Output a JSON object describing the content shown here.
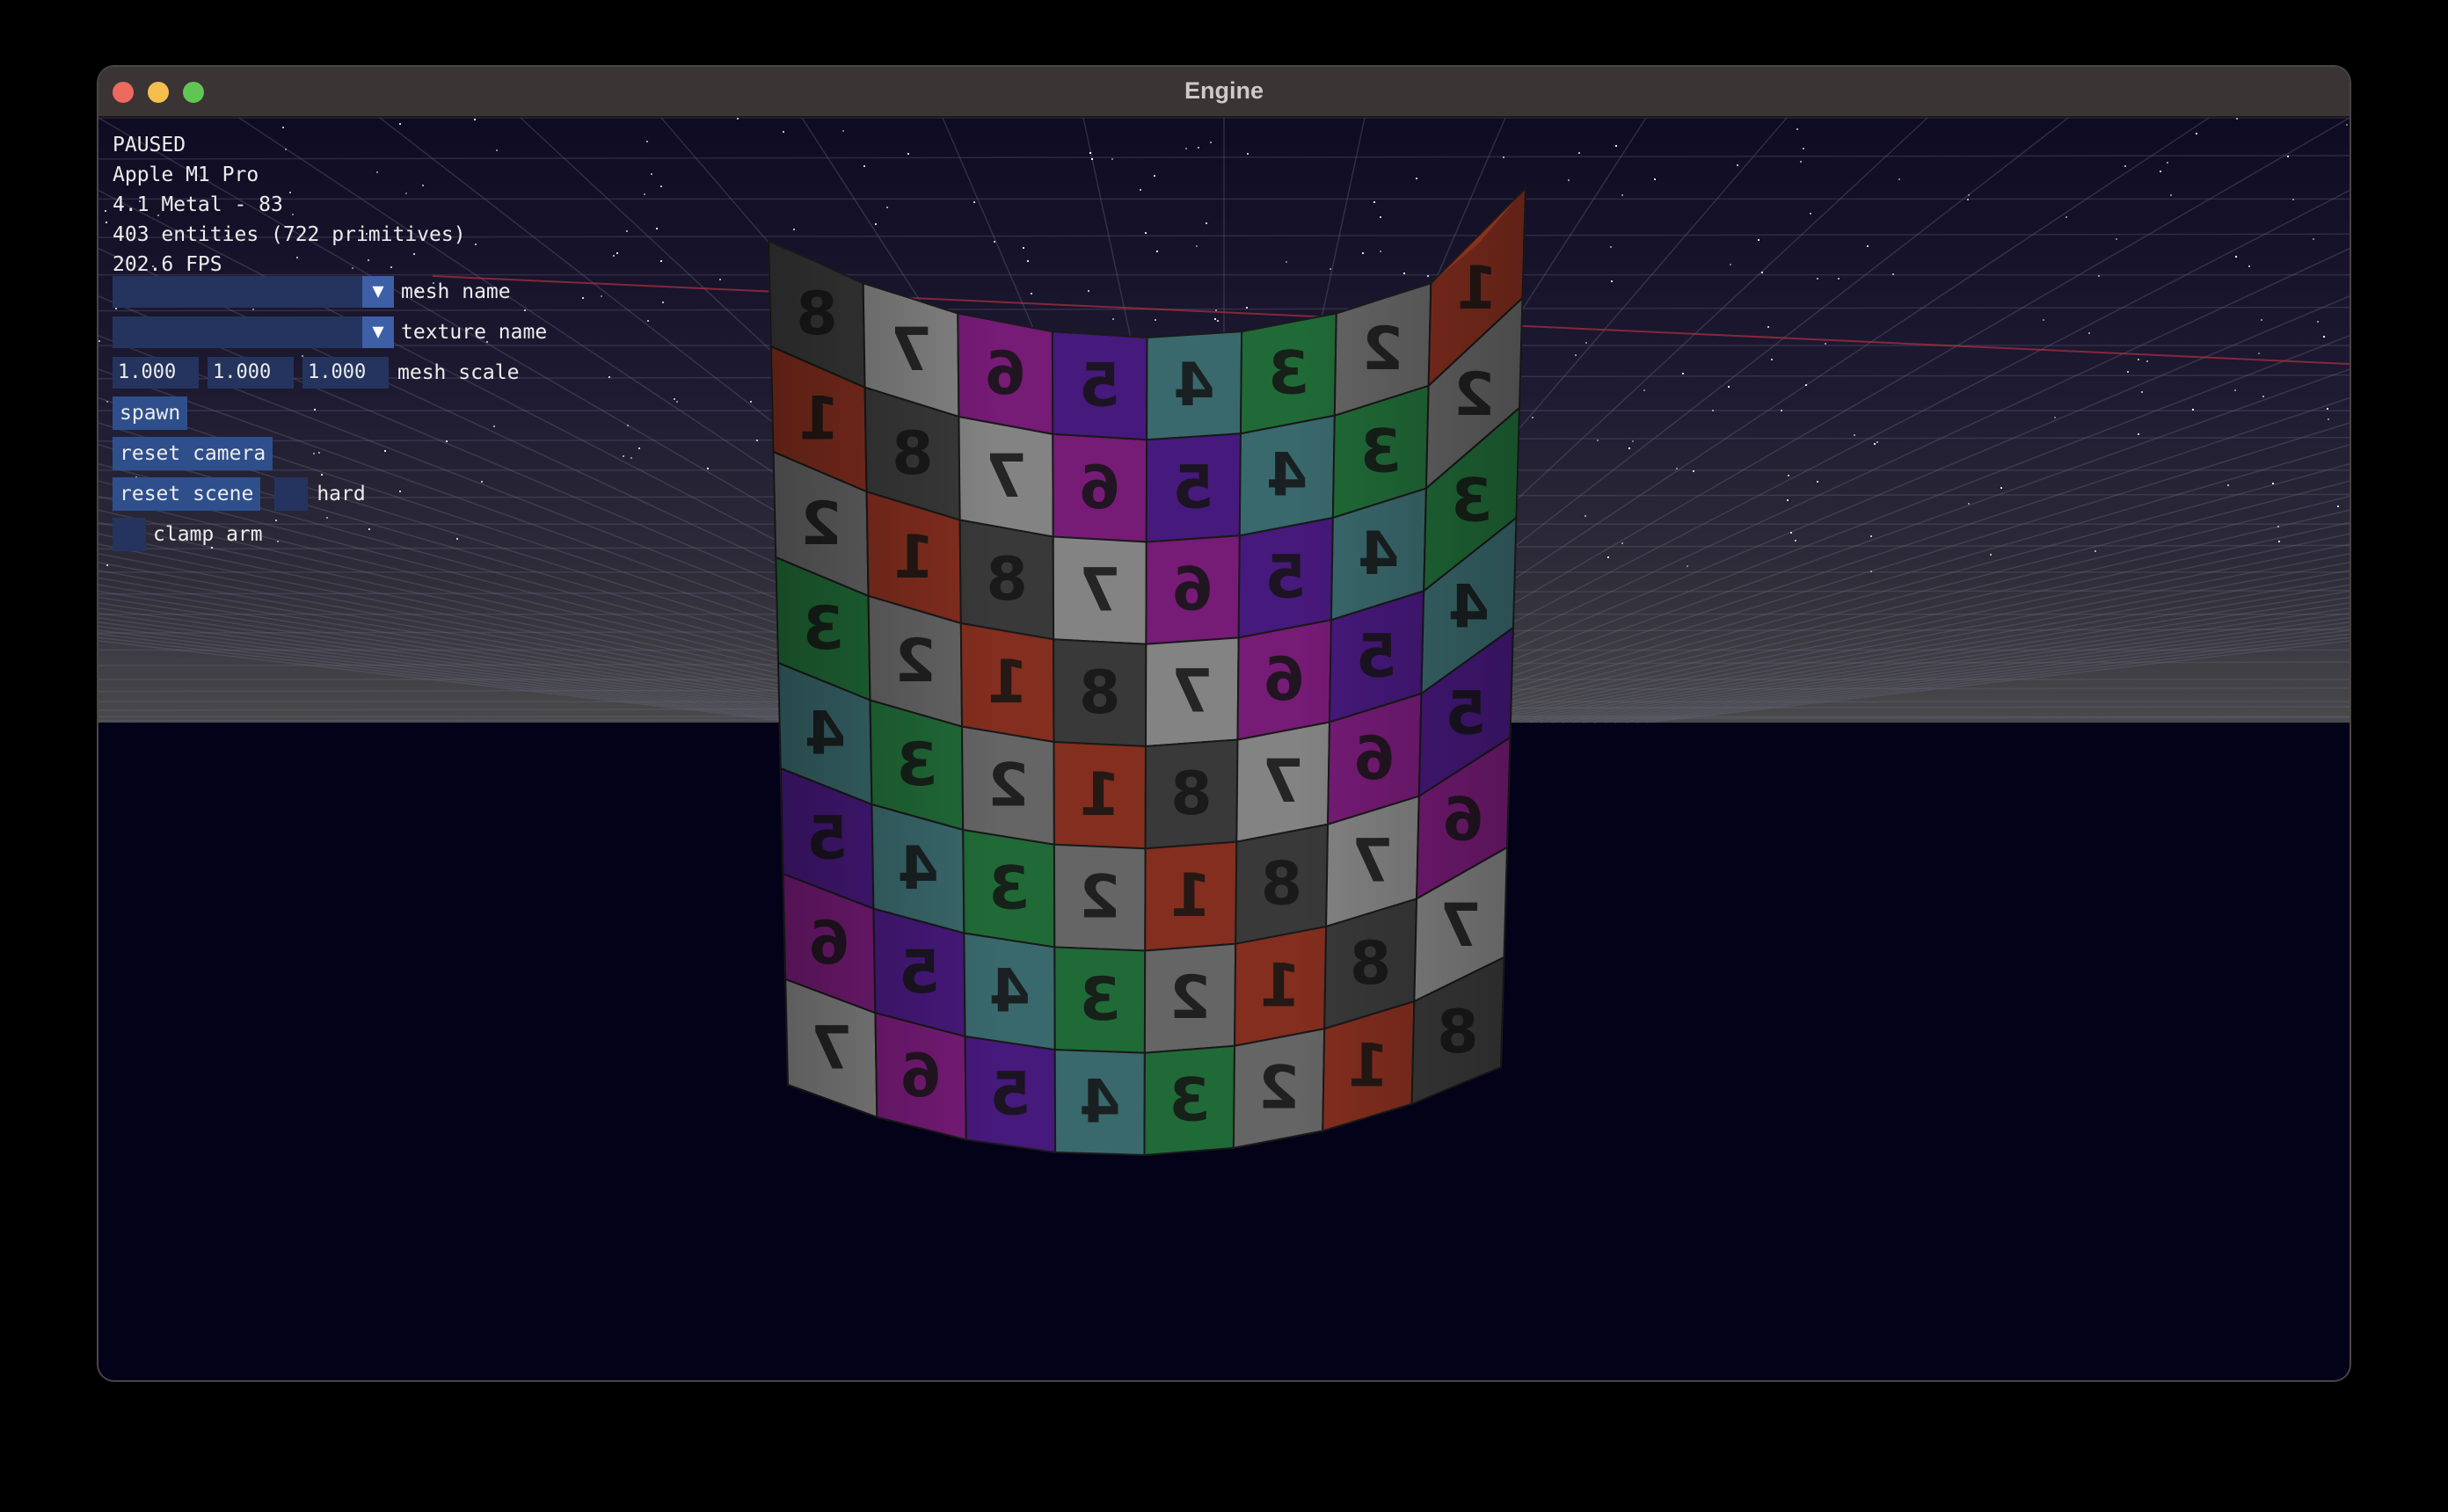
{
  "window": {
    "title": "Engine"
  },
  "status": {
    "state": "PAUSED",
    "gpu": "Apple M1 Pro",
    "api": "4.1 Metal - 83",
    "entities": "403 entities (722 primitives)",
    "fps": "202.6 FPS"
  },
  "controls": {
    "mesh_name": {
      "label": "mesh name",
      "value": ""
    },
    "texture_name": {
      "label": "texture name",
      "value": ""
    },
    "mesh_scale": {
      "label": "mesh scale",
      "x": "1.000",
      "y": "1.000",
      "z": "1.000"
    },
    "spawn_label": "spawn",
    "reset_camera_label": "reset camera",
    "reset_scene_label": "reset scene",
    "hard_label": "hard",
    "clamp_arm_label": "clamp arm"
  },
  "icons": {
    "dropdown": "chevron-down-icon"
  },
  "cloth": {
    "rows": [
      [
        "8",
        "7",
        "6",
        "5",
        "4",
        "3",
        "2",
        "1"
      ],
      [
        "1",
        "8",
        "7",
        "6",
        "5",
        "4",
        "3",
        "2"
      ],
      [
        "2",
        "1",
        "8",
        "7",
        "6",
        "5",
        "4",
        "3"
      ],
      [
        "3",
        "2",
        "1",
        "8",
        "7",
        "6",
        "5",
        "4"
      ],
      [
        "4",
        "3",
        "2",
        "1",
        "8",
        "7",
        "6",
        "5"
      ],
      [
        "5",
        "4",
        "3",
        "2",
        "1",
        "8",
        "7",
        "6"
      ],
      [
        "6",
        "5",
        "4",
        "3",
        "2",
        "1",
        "8",
        "7"
      ],
      [
        "7",
        "6",
        "5",
        "4",
        "3",
        "2",
        "1",
        "8"
      ]
    ],
    "colors": {
      "1": "#8a3020",
      "2": "#6a6a6a",
      "3": "#22703a",
      "4": "#3c6e72",
      "5": "#4a1a82",
      "6": "#7c1c7c",
      "7": "#8a8a8a",
      "8": "#3c3c3c"
    }
  }
}
